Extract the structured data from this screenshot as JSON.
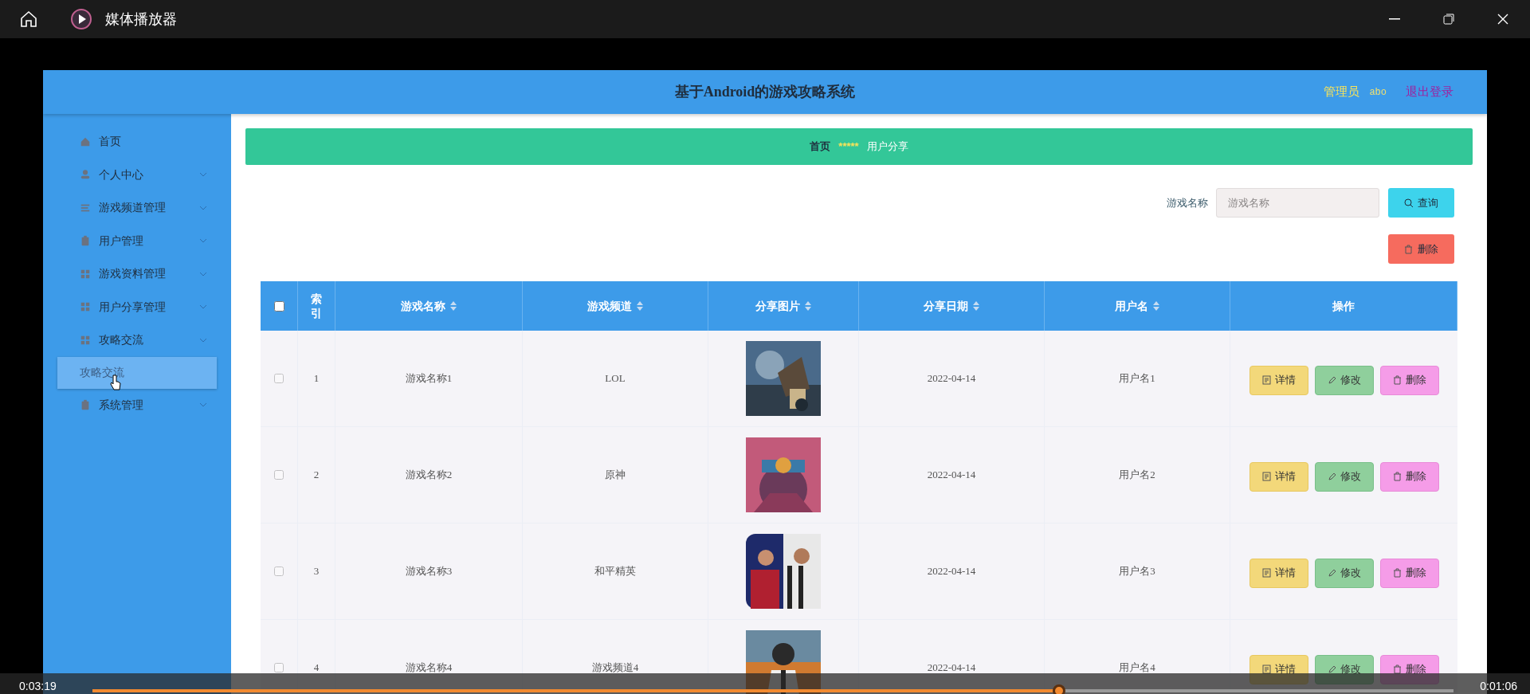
{
  "window": {
    "title": "媒体播放器"
  },
  "app": {
    "title": "基于Android的游戏攻略系统",
    "role": "管理员",
    "user": "abo",
    "logout": "退出登录"
  },
  "sidebar": {
    "items": [
      {
        "label": "首页",
        "kind": "link"
      },
      {
        "label": "个人中心",
        "kind": "menu"
      },
      {
        "label": "游戏频道管理",
        "kind": "menu"
      },
      {
        "label": "用户管理",
        "kind": "menu"
      },
      {
        "label": "游戏资料管理",
        "kind": "menu"
      },
      {
        "label": "用户分享管理",
        "kind": "menu"
      },
      {
        "label": "攻略交流",
        "kind": "menu",
        "children": [
          {
            "label": "攻略交流",
            "selected": true
          }
        ]
      },
      {
        "label": "系统管理",
        "kind": "menu"
      }
    ]
  },
  "breadcrumb": {
    "home": "首页",
    "separator": "*****",
    "current": "用户分享"
  },
  "search": {
    "label": "游戏名称",
    "placeholder": "游戏名称",
    "button": "查询"
  },
  "delete_button": "删除",
  "table": {
    "header_checked": false,
    "columns": [
      "索引",
      "游戏名称",
      "游戏频道",
      "分享图片",
      "分享日期",
      "用户名",
      "操作"
    ],
    "rows": [
      {
        "checked": false,
        "index": "1",
        "name": "游戏名称1",
        "channel": "LOL",
        "date": "2022-04-14",
        "user": "用户名1",
        "actions": [
          "详情",
          "修改",
          "删除"
        ]
      },
      {
        "checked": false,
        "index": "2",
        "name": "游戏名称2",
        "channel": "原神",
        "date": "2022-04-14",
        "user": "用户名2",
        "actions": [
          "详情",
          "修改",
          "删除"
        ]
      },
      {
        "checked": false,
        "index": "3",
        "name": "游戏名称3",
        "channel": "和平精英",
        "date": "2022-04-14",
        "user": "用户名3",
        "actions": [
          "详情",
          "修改",
          "删除"
        ]
      },
      {
        "checked": false,
        "index": "4",
        "name": "游戏名称4",
        "channel": "游戏频道4",
        "date": "2022-04-14",
        "user": "用户名4",
        "actions": [
          "详情",
          "修改",
          "删除"
        ]
      }
    ]
  },
  "player": {
    "elapsed": "0:03:19",
    "remaining": "0:01:06",
    "level": 0.71
  }
}
